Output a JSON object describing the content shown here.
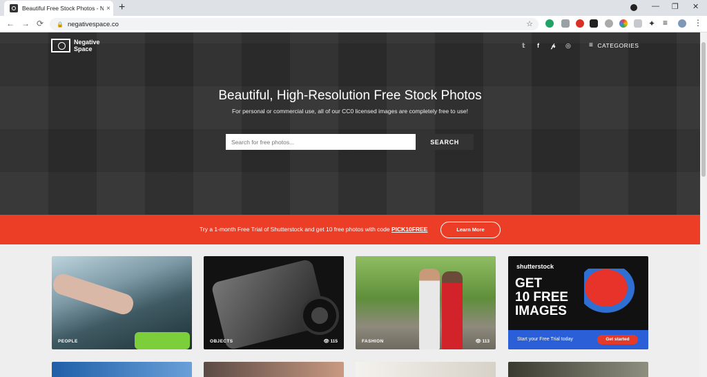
{
  "browser": {
    "tab_title": "Beautiful Free Stock Photos - Ne",
    "url": "negativespace.co",
    "tab_close": "×",
    "new_tab": "+"
  },
  "site": {
    "logo_text": "Negative Space",
    "categories_label": "CATEGORIES",
    "hero_title": "Beautiful, High-Resolution Free Stock Photos",
    "hero_subtitle": "For personal or commercial use, all of our CC0 licensed images are completely free to use!",
    "search_placeholder": "Search for free photos...",
    "search_button": "SEARCH"
  },
  "promo": {
    "text": "Try a 1-month Free Trial of Shutterstock and get 10 free photos with code",
    "code": "PICK10FREE",
    "button": "Learn More"
  },
  "cards": [
    {
      "label": "PEOPLE",
      "views": ""
    },
    {
      "label": "OBJECTS",
      "views": "👁 115"
    },
    {
      "label": "FASHION",
      "views": "👁 113"
    }
  ],
  "ad": {
    "brand": "shutterstock",
    "line1": "GET",
    "line2": "10 FREE",
    "line3": "IMAGES",
    "bar_text": "Start your Free Trial today",
    "bar_button": "Get started"
  },
  "colors": {
    "promo_red": "#ec3d26",
    "hero_dark": "#2e2e2e",
    "ad_blue": "#2b5fd8"
  }
}
